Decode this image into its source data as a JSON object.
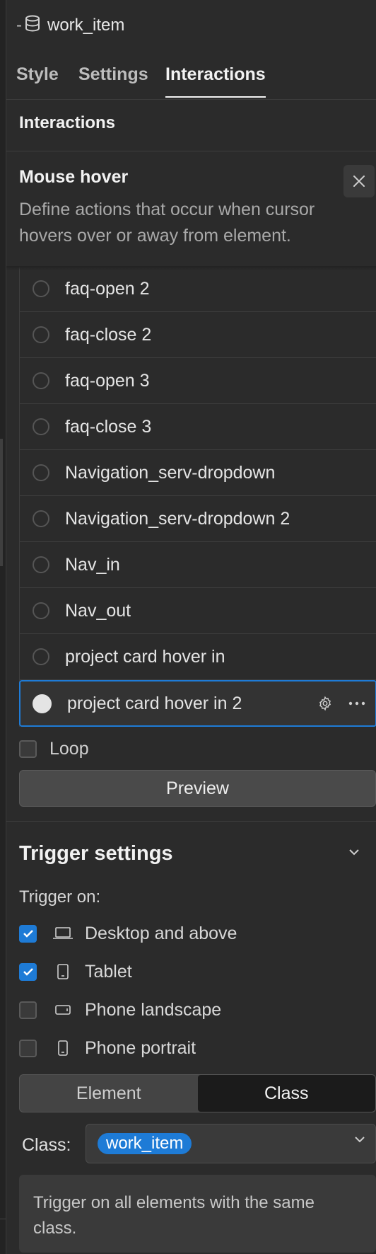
{
  "element": {
    "prefix": "-",
    "name": "work_item"
  },
  "tabs": [
    {
      "label": "Style"
    },
    {
      "label": "Settings"
    },
    {
      "label": "Interactions",
      "active": true
    }
  ],
  "section_title": "Interactions",
  "mouse_hover": {
    "title": "Mouse hover",
    "description": "Define actions that occur when cursor hovers over or away from element."
  },
  "animations": [
    {
      "label": "faq-open 2"
    },
    {
      "label": "faq-close 2"
    },
    {
      "label": "faq-open 3"
    },
    {
      "label": "faq-close 3"
    },
    {
      "label": "Navigation_serv-dropdown"
    },
    {
      "label": "Navigation_serv-dropdown 2"
    },
    {
      "label": "Nav_in"
    },
    {
      "label": "Nav_out"
    },
    {
      "label": "project card hover in"
    },
    {
      "label": "project card hover in 2",
      "selected": true
    }
  ],
  "loop": {
    "label": "Loop",
    "checked": false
  },
  "preview_label": "Preview",
  "trigger": {
    "title": "Trigger settings",
    "on_label": "Trigger on:",
    "devices": [
      {
        "label": "Desktop and above",
        "icon": "laptop-icon",
        "checked": true
      },
      {
        "label": "Tablet",
        "icon": "tablet-icon",
        "checked": true
      },
      {
        "label": "Phone landscape",
        "icon": "phone-landscape-icon",
        "checked": false
      },
      {
        "label": "Phone portrait",
        "icon": "phone-portrait-icon",
        "checked": false
      }
    ],
    "mode_options": [
      {
        "label": "Element",
        "active": false
      },
      {
        "label": "Class",
        "active": true
      }
    ],
    "class_label": "Class:",
    "class_value": "work_item",
    "hint": "Trigger on all elements with the same class."
  },
  "colors": {
    "accent": "#1e7bd6",
    "panel_bg": "#2b2b2b",
    "text": "#e6e6e6",
    "muted_text": "#a9a9a9"
  }
}
